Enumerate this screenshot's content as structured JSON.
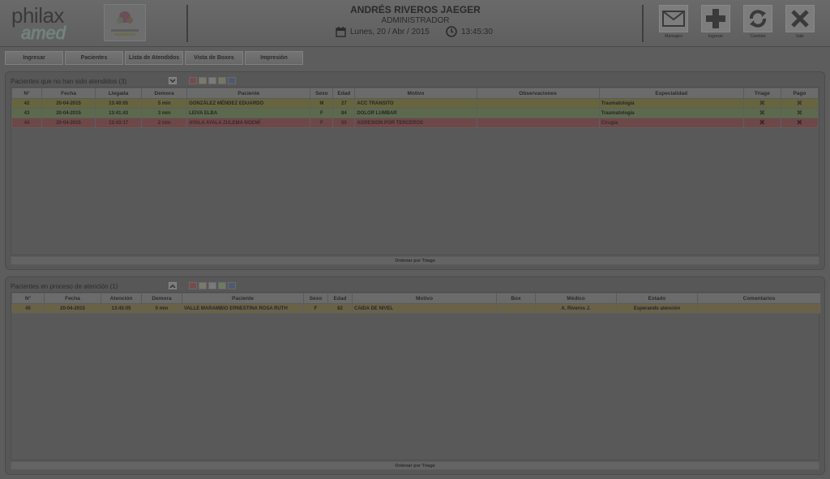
{
  "header": {
    "logo_text_1": "philax",
    "logo_text_2": "amed",
    "user_name": "ANDRÉS RIVEROS JAEGER",
    "user_role": "ADMINISTRADOR",
    "date": "Lunes, 20 / Abr / 2015",
    "time": "13:45:30",
    "toolbar": {
      "messages_label": "Mensajes",
      "add_label": "Ingresar",
      "refresh_label": "Cambiar",
      "exit_label": "Salir"
    }
  },
  "menu": {
    "items": [
      "Ingresar",
      "Pacientes",
      "Lista de Atendidos",
      "Vista de Boxes",
      "Impresión"
    ]
  },
  "waiting_panel": {
    "title": "Pacientes que no han sido atendidos (3)",
    "columns": [
      "N°",
      "Fecha",
      "Llegada",
      "Demora",
      "Paciente",
      "Sexo",
      "Edad",
      "Motivo",
      "Observaciones",
      "Especialidad",
      "Triage",
      "Pago"
    ],
    "rows": [
      {
        "n": "42",
        "fecha": "20-04-2015",
        "llegada": "13:40:05",
        "demora": "5 min",
        "paciente": "GONZÁLEZ MÉNDEZ EDUARDO",
        "sexo": "M",
        "edad": "27",
        "motivo": "ACC TRANSITO",
        "observaciones": "",
        "especialidad": "Traumatología",
        "triage": "✖",
        "pago": "✖"
      },
      {
        "n": "43",
        "fecha": "20-04-2015",
        "llegada": "13:41:43",
        "demora": "3 min",
        "paciente": "LEIVA ELBA",
        "sexo": "F",
        "edad": "84",
        "motivo": "DOLOR LUMBAR",
        "observaciones": "",
        "especialidad": "Traumatología",
        "triage": "✖",
        "pago": "✖"
      },
      {
        "n": "44",
        "fecha": "20-04-2015",
        "llegada": "13:43:17",
        "demora": "2 min",
        "paciente": "AYALA AYALA ZULEMA NOEMÍ",
        "sexo": "F",
        "edad": "55",
        "motivo": "AGRESION POR TERCEROS",
        "observaciones": "",
        "especialidad": "Cirugía",
        "triage": "✖",
        "pago": "✖"
      }
    ],
    "footer": "Ordenar por Triage"
  },
  "progress_panel": {
    "title": "Pacientes en proceso de atención (1)",
    "columns": [
      "N°",
      "Fecha",
      "Atención",
      "Demora",
      "Paciente",
      "Sexo",
      "Edad",
      "Motivo",
      "Box",
      "Médico",
      "Estado",
      "Comentarios"
    ],
    "rows": [
      {
        "n": "45",
        "fecha": "20-04-2015",
        "atencion": "13:45:05",
        "demora": "0 min",
        "paciente": "VALLE MARAMBIO ERNESTINA ROSA RUTH",
        "sexo": "F",
        "edad": "82",
        "motivo": "CAIDA DE NIVEL",
        "box": "",
        "medico": "A. Riveros J.",
        "estado": "Esperando atención",
        "comentarios": ""
      }
    ],
    "footer": "Ordenar por Triage"
  },
  "colors": {
    "filter_1": "#7a4a4a",
    "filter_2": "#7a7a6a",
    "filter_3": "#7a7a7a",
    "filter_4": "#6f7a62",
    "filter_5": "#4e5a70"
  }
}
